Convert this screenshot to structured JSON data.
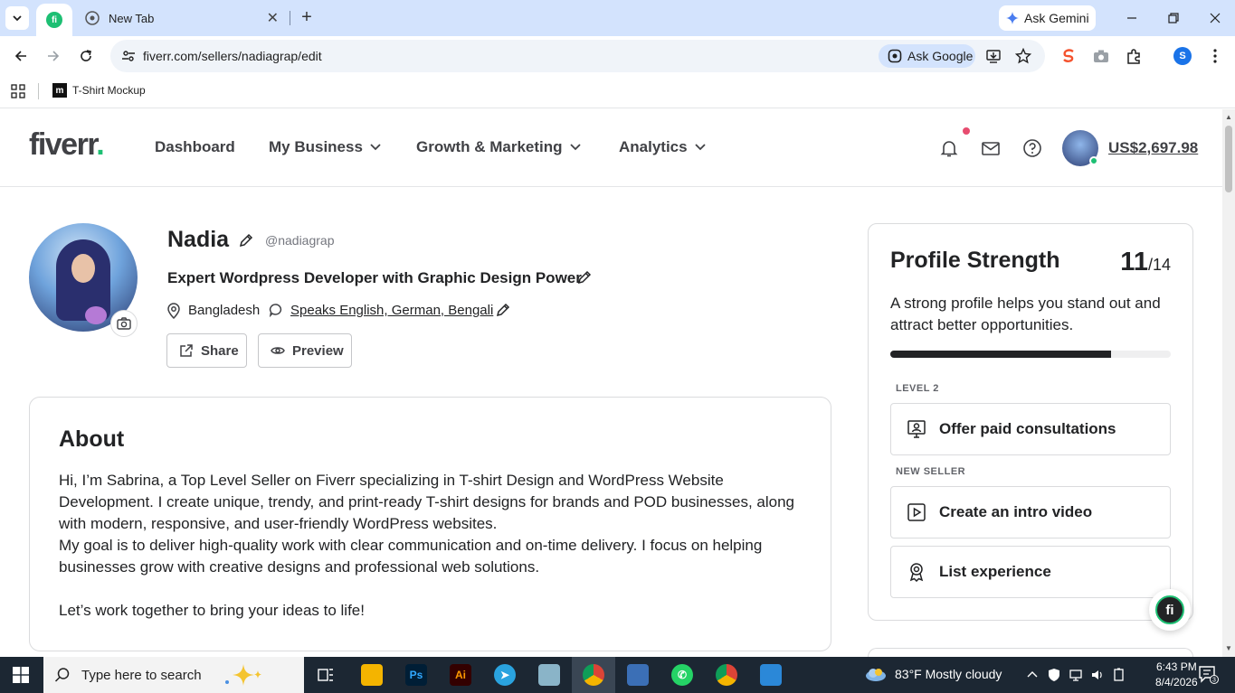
{
  "browser": {
    "tabs": [
      {
        "label": "New Tab"
      }
    ],
    "ask_gemini": "Ask Gemini",
    "url": "fiverr.com/sellers/nadiagrap/edit",
    "ask_google": "Ask Google",
    "bookmark": "T-Shirt Mockup",
    "profile_initial": "S"
  },
  "header": {
    "logo": "fiverr",
    "logo_dot": ".",
    "nav": [
      {
        "label": "Dashboard"
      },
      {
        "label": "My Business"
      },
      {
        "label": "Growth & Marketing"
      },
      {
        "label": "Analytics"
      }
    ],
    "balance": "US$2,697.98"
  },
  "profile": {
    "name": "Nadia",
    "username": "@nadiagrap",
    "tagline": "Expert Wordpress Developer with Graphic Design Power",
    "location": "Bangladesh",
    "languages": "Speaks English, German, Bengali",
    "share_label": "Share",
    "preview_label": "Preview"
  },
  "about": {
    "title": "About",
    "p1": "Hi, I’m Sabrina, a Top Level Seller on Fiverr specializing in T-shirt Design and WordPress Website Development. I create unique, trendy, and print-ready T-shirt designs for brands and POD businesses, along with modern, responsive, and user-friendly WordPress websites.",
    "p2": "My goal is to deliver high-quality work with clear communication and on-time delivery. I focus on helping businesses grow with creative designs and professional web solutions.",
    "p3": "Let’s work together to bring your ideas to life!"
  },
  "strength": {
    "title": "Profile Strength",
    "score": "11",
    "total": "/14",
    "progress_fraction": 0.786,
    "description": "A strong profile helps you stand out and attract better opportunities.",
    "level2_label": "LEVEL 2",
    "task_consult": "Offer paid consultations",
    "new_seller_label": "NEW SELLER",
    "task_video": "Create an intro video",
    "task_experience": "List experience"
  },
  "taskbar": {
    "search_placeholder": "Type here to search",
    "weather": "83°F  Mostly cloudy",
    "time": "6:43 PM",
    "date": "8/4/2026",
    "notification_count": "3"
  },
  "colors": {
    "brand_green": "#1dbf73",
    "chrome_tab_bar": "#d3e3fd",
    "text_dark": "#222325"
  }
}
